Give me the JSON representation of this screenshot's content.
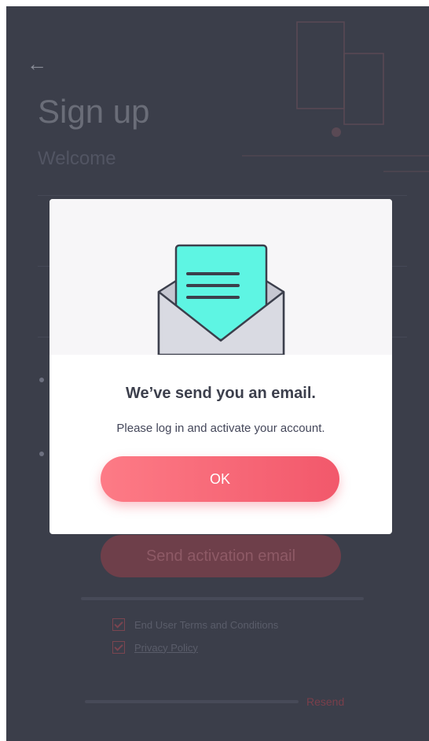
{
  "header": {
    "back_icon": "back-arrow-icon",
    "title": "Sign up",
    "subtitle": "Welcome"
  },
  "background_form": {
    "send_button_label": "Send activation email",
    "terms_label": "End User Terms and Conditions",
    "privacy_label": "Privacy Policy",
    "resend_label": "Resend"
  },
  "modal": {
    "illustration": "envelope-email-icon",
    "heading": "We’ve send you an email.",
    "message": "Please log in and activate your account.",
    "ok_label": "OK"
  },
  "colors": {
    "accent": "#f2586b",
    "mint": "#5ef5e3",
    "overlay": "#3b3e4a"
  }
}
